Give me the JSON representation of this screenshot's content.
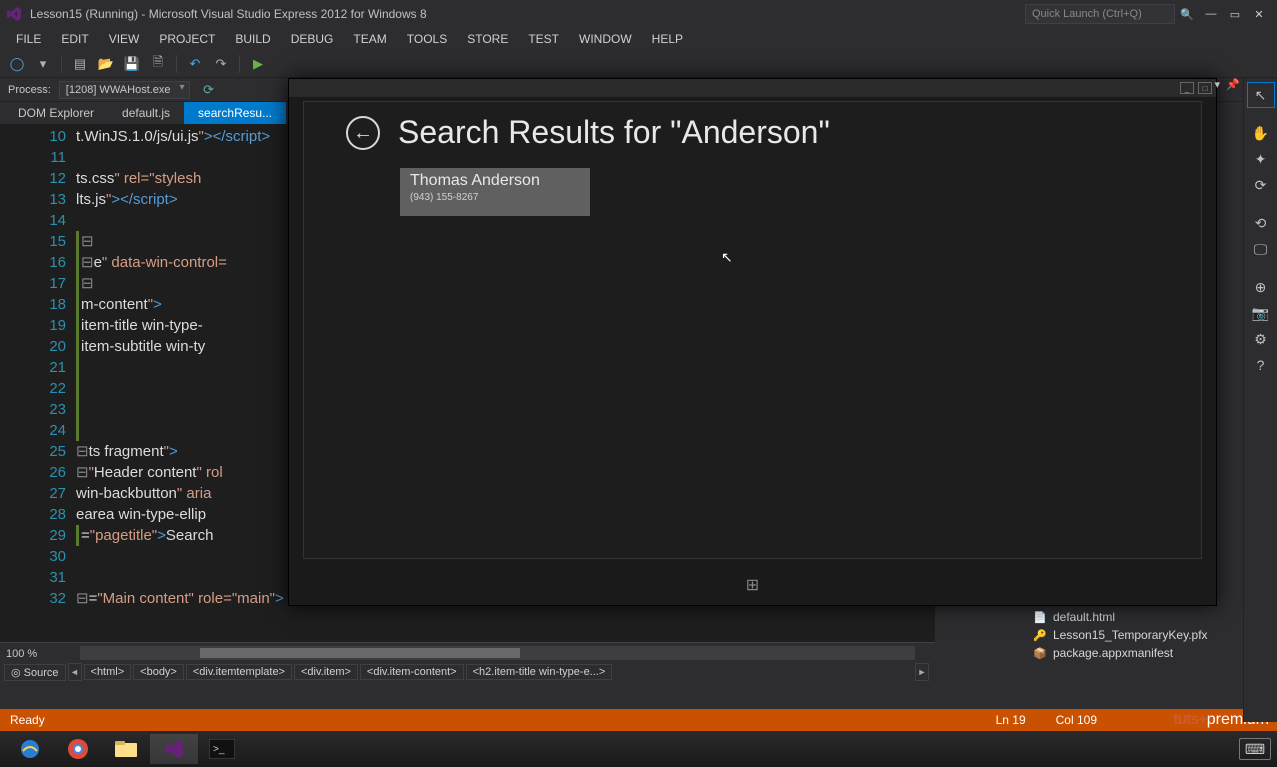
{
  "titlebar": {
    "title": "Lesson15 (Running) - Microsoft Visual Studio Express 2012 for Windows 8",
    "quicklaunch_placeholder": "Quick Launch (Ctrl+Q)"
  },
  "menubar": [
    "FILE",
    "EDIT",
    "VIEW",
    "PROJECT",
    "BUILD",
    "DEBUG",
    "TEAM",
    "TOOLS",
    "STORE",
    "TEST",
    "WINDOW",
    "HELP"
  ],
  "debugrow": {
    "process_label": "Process:",
    "process_value": "[1208] WWAHost.exe"
  },
  "doc_tabs": [
    {
      "label": "DOM Explorer",
      "active": false
    },
    {
      "label": "default.js",
      "active": false
    },
    {
      "label": "searchResu...",
      "active": true
    }
  ],
  "editor": {
    "first_line_no": 10,
    "last_line_no": 32,
    "zoom": "100 %",
    "breadcrumb": [
      "<html>",
      "<body>",
      "<div.itemtemplate>",
      "<div.item>",
      "<div.item-content>",
      "<h2.item-title win-type-e...>"
    ],
    "source_label": "◎ Source",
    "lines": [
      {
        "n": 10,
        "m": false,
        "o": false,
        "html": "t.WinJS.1.0/js/ui.js<span class='c-red'>\"</span><span class='c-blue'>&gt;&lt;/script&gt;</span>"
      },
      {
        "n": 11,
        "m": false,
        "o": false,
        "html": ""
      },
      {
        "n": 12,
        "m": false,
        "o": false,
        "html": "ts.css<span class='c-red'>\"</span> <span class='c-red'>rel=</span><span class='c-red'>\"stylesh</span>"
      },
      {
        "n": 13,
        "m": false,
        "o": false,
        "html": "lts.js<span class='c-red'>\"</span><span class='c-blue'>&gt;&lt;/script&gt;</span>"
      },
      {
        "n": 14,
        "m": false,
        "o": false,
        "html": ""
      },
      {
        "n": 15,
        "m": true,
        "o": true,
        "html": ""
      },
      {
        "n": 16,
        "m": true,
        "o": true,
        "html": "e<span class='c-red'>\"</span> <span class='c-red'>data-win-control=</span>"
      },
      {
        "n": 17,
        "m": true,
        "o": true,
        "html": ""
      },
      {
        "n": 18,
        "m": true,
        "o": false,
        "html": "m-content<span class='c-red'>\"</span><span class='c-blue'>&gt;</span>"
      },
      {
        "n": 19,
        "m": true,
        "o": false,
        "html": "item-title win-type-"
      },
      {
        "n": 20,
        "m": true,
        "o": false,
        "html": "item-subtitle win-ty"
      },
      {
        "n": 21,
        "m": true,
        "o": false,
        "html": ""
      },
      {
        "n": 22,
        "m": true,
        "o": false,
        "html": ""
      },
      {
        "n": 23,
        "m": true,
        "o": false,
        "html": ""
      },
      {
        "n": 24,
        "m": true,
        "o": false,
        "html": ""
      },
      {
        "n": 25,
        "m": false,
        "o": true,
        "html": "ts fragment<span class='c-red'>\"</span><span class='c-blue'>&gt;</span>"
      },
      {
        "n": 26,
        "m": false,
        "o": true,
        "html": "<span class='c-red'>\"</span>Header content<span class='c-red'>\"</span> <span class='c-red'>rol</span>"
      },
      {
        "n": 27,
        "m": false,
        "o": false,
        "html": "win-backbutton<span class='c-red'>\"</span> <span class='c-red'>aria</span>"
      },
      {
        "n": 28,
        "m": false,
        "o": false,
        "html": "earea win-type-ellip"
      },
      {
        "n": 29,
        "m": true,
        "o": false,
        "html": "=<span class='c-red'>\"pagetitle\"</span><span class='c-blue'>&gt;</span>Search "
      },
      {
        "n": 30,
        "m": false,
        "o": false,
        "html": ""
      },
      {
        "n": 31,
        "m": false,
        "o": false,
        "html": ""
      },
      {
        "n": 32,
        "m": false,
        "o": true,
        "html": "=<span class='c-red'>\"Main content\"</span> <span class='c-red'>role=</span><span class='c-red'>\"main\"</span><span class='c-blue'>&gt;</span>"
      }
    ]
  },
  "simulator": {
    "page_title": "Search Results for \"Anderson\"",
    "result_name": "Thomas Anderson",
    "result_phone": "(943) 155-8267"
  },
  "right_tools": [
    {
      "name": "pointer-icon",
      "glyph": "↖",
      "active": true
    },
    {
      "name": "hand-icon",
      "glyph": "✋"
    },
    {
      "name": "pinch-icon",
      "glyph": "✦"
    },
    {
      "name": "rotate-cw-icon",
      "glyph": "⟳"
    },
    {
      "name": "rotate-ccw-icon",
      "glyph": "⟲"
    },
    {
      "name": "monitor-icon",
      "glyph": "🖵"
    },
    {
      "name": "globe-icon",
      "glyph": "⊕"
    },
    {
      "name": "camera-icon",
      "glyph": "📷"
    },
    {
      "name": "gear-icon",
      "glyph": "⚙"
    },
    {
      "name": "help-icon",
      "glyph": "?"
    }
  ],
  "solution_panel": [
    {
      "icon": "📄",
      "label": "default.html"
    },
    {
      "icon": "🔑",
      "label": "Lesson15_TemporaryKey.pfx"
    },
    {
      "icon": "📦",
      "label": "package.appxmanifest"
    }
  ],
  "statusbar": {
    "state": "Ready",
    "line": "Ln 19",
    "col": "Col 109"
  },
  "watermark": {
    "a": "tuts+",
    "b": "premium"
  },
  "taskbar_icons": [
    "ie",
    "chrome",
    "explorer",
    "vs",
    "console"
  ]
}
